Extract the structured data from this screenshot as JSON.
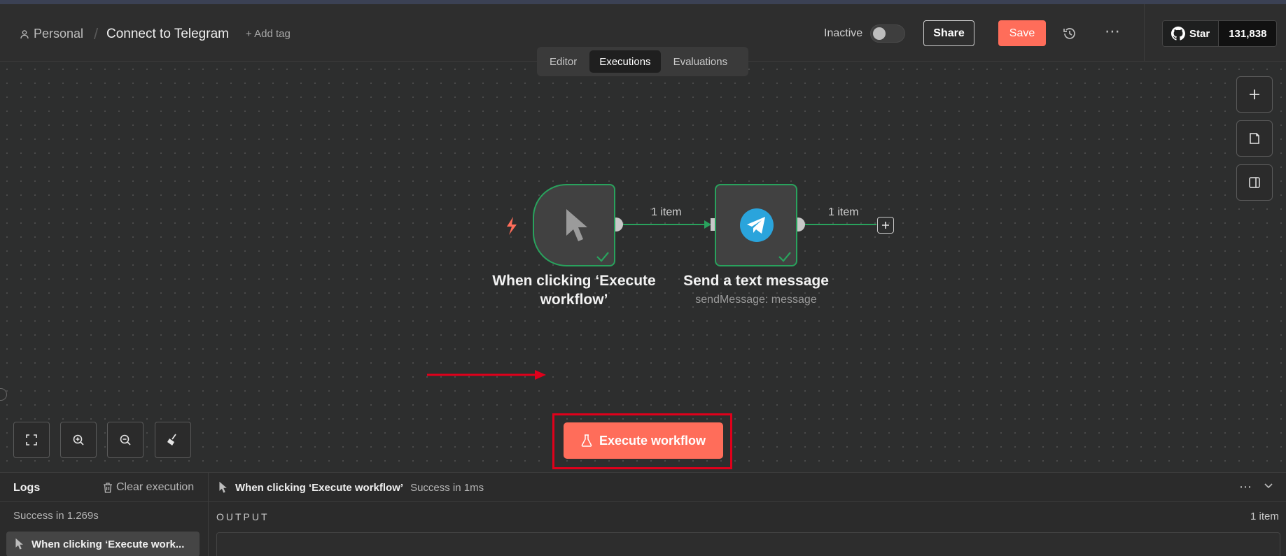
{
  "breadcrumb": {
    "owner": "Personal",
    "workflow_title": "Connect to Telegram",
    "add_tag": "+ Add tag"
  },
  "header": {
    "active_state_label": "Inactive",
    "active": false,
    "share_label": "Share",
    "save_label": "Save",
    "github": {
      "star_label": "Star",
      "star_count": "131,838"
    }
  },
  "tabs": [
    {
      "label": "Editor",
      "active": false
    },
    {
      "label": "Executions",
      "active": true
    },
    {
      "label": "Evaluations",
      "active": false
    }
  ],
  "nodes": [
    {
      "title": "When clicking ‘Execute workflow’",
      "subtitle": "",
      "icon": "cursor-icon",
      "status": "success"
    },
    {
      "title": "Send a text message",
      "subtitle": "sendMessage: message",
      "icon": "telegram-icon",
      "status": "success"
    }
  ],
  "edges": [
    {
      "label": "1 item"
    },
    {
      "label": "1 item"
    }
  ],
  "execute_button": {
    "label": "Execute workflow"
  },
  "logs": {
    "title": "Logs",
    "clear_label": "Clear execution",
    "total_status": "Success in 1.269s",
    "entries": [
      {
        "label": "When clicking ‘Execute work..."
      }
    ],
    "selected_run": {
      "name": "When clicking ‘Execute workflow’",
      "status": "Success in 1ms"
    },
    "output_label": "OUTPUT",
    "item_count": "1 item"
  },
  "colors": {
    "accent": "#ff6d5a",
    "success": "#29a25d",
    "telegram": "#2aa4dc",
    "highlight": "#e0001b"
  }
}
